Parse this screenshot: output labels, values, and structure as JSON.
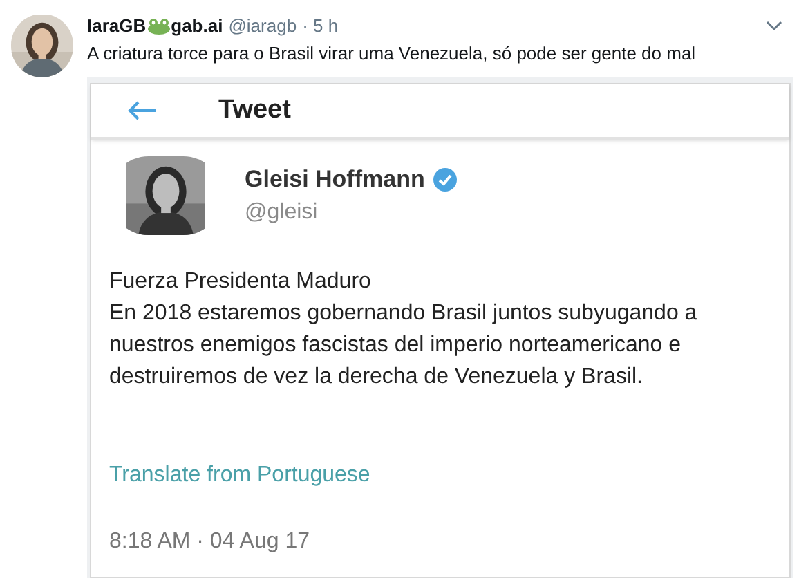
{
  "tweet": {
    "name_before": "IaraGB",
    "name_after": "gab.ai",
    "handle": "@iaragb",
    "time": "· 5 h",
    "text": "A criatura torce para o Brasil virar uma Venezuela, só pode ser gente do mal",
    "image": {
      "kind": "screenshot",
      "header_title": "Tweet",
      "author": "Gleisi Hoffmann",
      "verified": true,
      "handle": "@gleisi",
      "lines": [
        "Fuerza Presidenta Maduro",
        "En 2018 estaremos gobernando Brasil juntos subyugando a",
        "nuestros enemigos fascistas del imperio norteamericano e",
        "destruiremos de vez la derecha de Venezuela y Brasil."
      ],
      "translate": "Translate from Portuguese",
      "timestamp": "8:18 AM · 04 Aug 17"
    }
  }
}
